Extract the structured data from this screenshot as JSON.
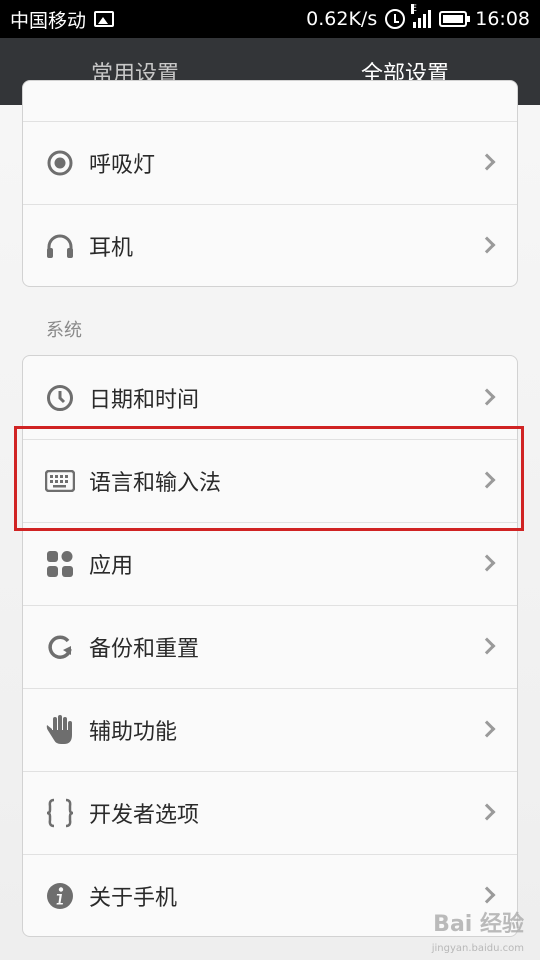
{
  "status_bar": {
    "carrier": "中国移动",
    "speed": "0.62K/s",
    "network_letter": "E",
    "time": "16:08"
  },
  "tabs": [
    {
      "label": "常用设置",
      "active": false
    },
    {
      "label": "全部设置",
      "active": true
    }
  ],
  "group_top": {
    "items": [
      {
        "label": "呼吸灯",
        "icon": "breathing-light-icon"
      },
      {
        "label": "耳机",
        "icon": "headphones-icon"
      }
    ]
  },
  "system_section": {
    "title": "系统",
    "items": [
      {
        "label": "日期和时间",
        "icon": "clock-icon"
      },
      {
        "label": "语言和输入法",
        "icon": "keyboard-icon"
      },
      {
        "label": "应用",
        "icon": "apps-icon"
      },
      {
        "label": "备份和重置",
        "icon": "refresh-icon"
      },
      {
        "label": "辅助功能",
        "icon": "hand-icon"
      },
      {
        "label": "开发者选项",
        "icon": "braces-icon"
      },
      {
        "label": "关于手机",
        "icon": "info-icon"
      }
    ]
  },
  "watermark": {
    "text": "Bai 经验",
    "sub": "jingyan.baidu.com"
  },
  "colors": {
    "tab_bar": "#333538",
    "highlight": "#d02323",
    "icon": "#6e6e6e"
  }
}
